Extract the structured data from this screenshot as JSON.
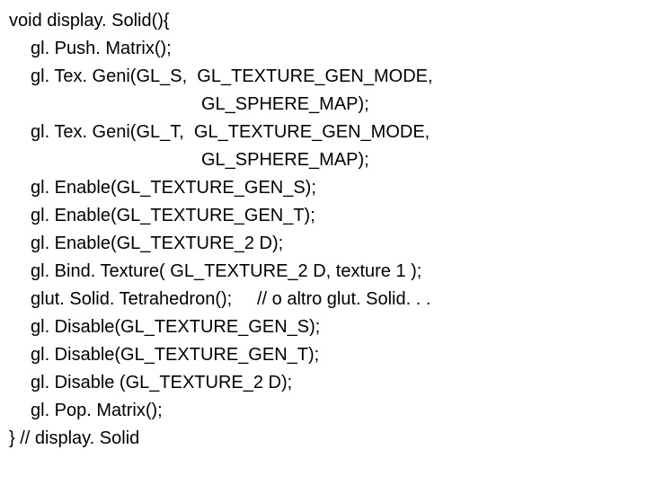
{
  "code": {
    "line1": "void display. Solid(){",
    "line2": "gl. Push. Matrix();",
    "line3": "gl. Tex. Geni(GL_S,  GL_TEXTURE_GEN_MODE,",
    "line4": "GL_SPHERE_MAP);",
    "line5": "gl. Tex. Geni(GL_T,  GL_TEXTURE_GEN_MODE,",
    "line6": "GL_SPHERE_MAP);",
    "line7": "gl. Enable(GL_TEXTURE_GEN_S);",
    "line8": "gl. Enable(GL_TEXTURE_GEN_T);",
    "line9": "gl. Enable(GL_TEXTURE_2 D);",
    "line10": "gl. Bind. Texture( GL_TEXTURE_2 D, texture 1 );",
    "line11": "glut. Solid. Tetrahedron();     // o altro glut. Solid. . .",
    "line12": "gl. Disable(GL_TEXTURE_GEN_S);",
    "line13": "gl. Disable(GL_TEXTURE_GEN_T);",
    "line14": "gl. Disable (GL_TEXTURE_2 D);",
    "line15": "gl. Pop. Matrix();",
    "line16": "} // display. Solid"
  }
}
